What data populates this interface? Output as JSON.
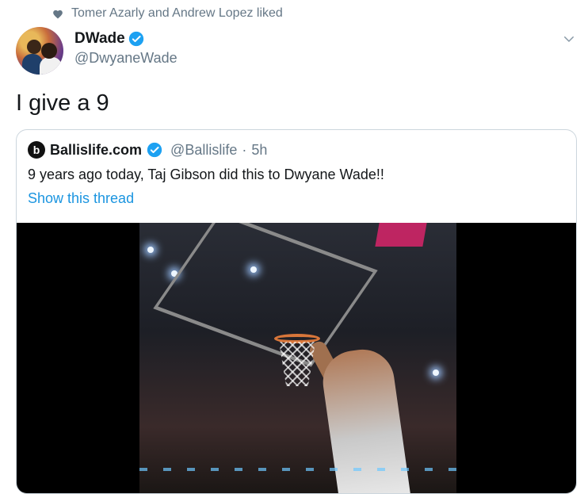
{
  "social_context": {
    "icon": "heart-icon",
    "text": "Tomer Azarly and Andrew Lopez liked"
  },
  "tweet": {
    "author_name": "DWade",
    "author_handle": "@DwyaneWade",
    "text": "I give a 9",
    "verified": true
  },
  "quote": {
    "author_name": "Ballislife.com",
    "author_handle": "@Ballislife",
    "separator": "·",
    "time": "5h",
    "text": "9 years ago today, Taj Gibson did this to Dwyane Wade!!",
    "show_thread": "Show this thread",
    "verified": true
  },
  "colors": {
    "link": "#1b95e0",
    "muted": "#657786",
    "verified": "#1da1f2",
    "border": "#ccd6dd"
  }
}
